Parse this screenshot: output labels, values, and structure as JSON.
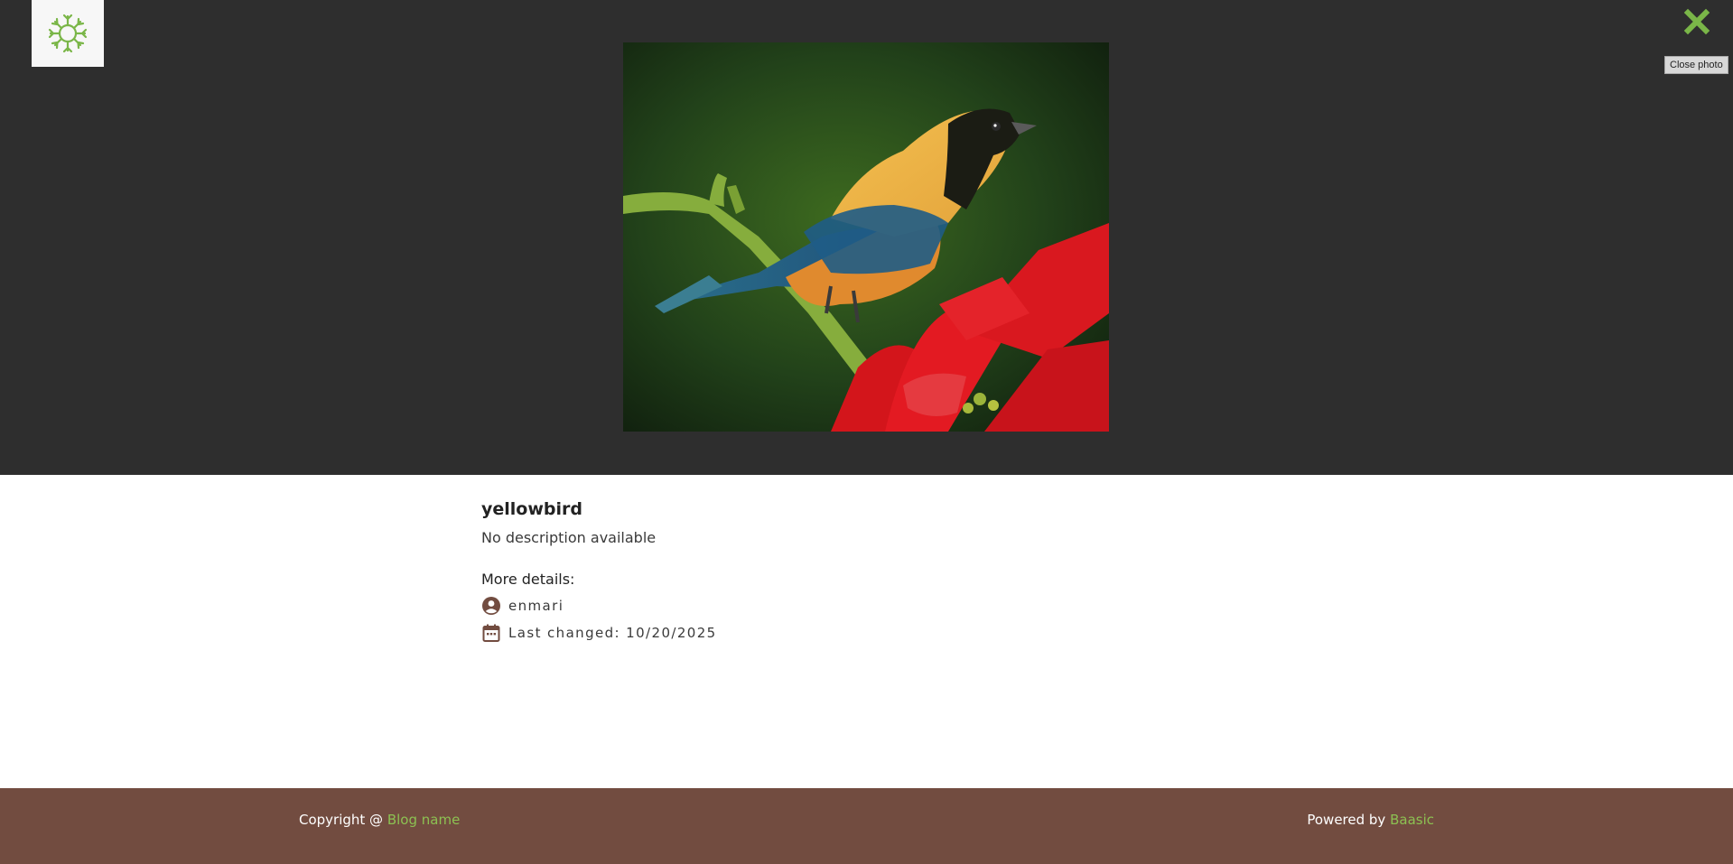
{
  "header": {
    "logo_icon": "sun-logo-icon",
    "close_icon": "close-icon",
    "close_tooltip": "Close photo",
    "accent_color": "#7ab648"
  },
  "photo": {
    "name": "yellowbird",
    "description": "No description available",
    "more_details_label": "More details:",
    "author_icon": "account-circle-icon",
    "author": "enmari",
    "date_icon": "calendar-icon",
    "last_changed": "Last changed: 10/20/2025"
  },
  "footer": {
    "copyright_prefix": "Copyright @",
    "blog_name": "Blog name",
    "powered_prefix": "Powered by",
    "powered_name": "Baasic",
    "background": "#724c40",
    "link_color": "#8cc152"
  }
}
